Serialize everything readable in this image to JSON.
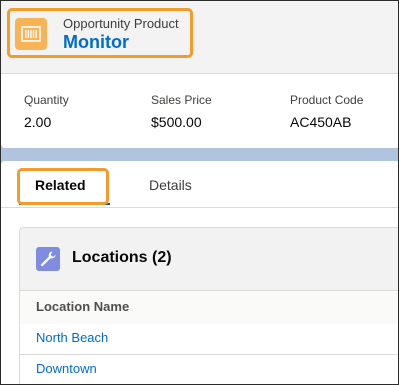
{
  "header": {
    "object_type": "Opportunity Product",
    "record_name": "Monitor"
  },
  "fields": [
    {
      "label": "Quantity",
      "value": "2.00"
    },
    {
      "label": "Sales Price",
      "value": "$500.00"
    },
    {
      "label": "Product Code",
      "value": "AC450AB"
    }
  ],
  "tabs": [
    {
      "label": "Related",
      "active": true
    },
    {
      "label": "Details",
      "active": false
    }
  ],
  "related_list": {
    "title": "Locations (2)",
    "column_header": "Location Name",
    "rows": [
      "North Beach",
      "Downtown"
    ]
  },
  "colors": {
    "highlight": "#f39c2a",
    "link": "#006dcc",
    "product_icon_bg": "#f8b356",
    "related_icon_bg": "#7f8de1",
    "page_bg": "#b0c4df"
  },
  "icons": {
    "product": "product-icon",
    "related": "wrench-icon"
  }
}
